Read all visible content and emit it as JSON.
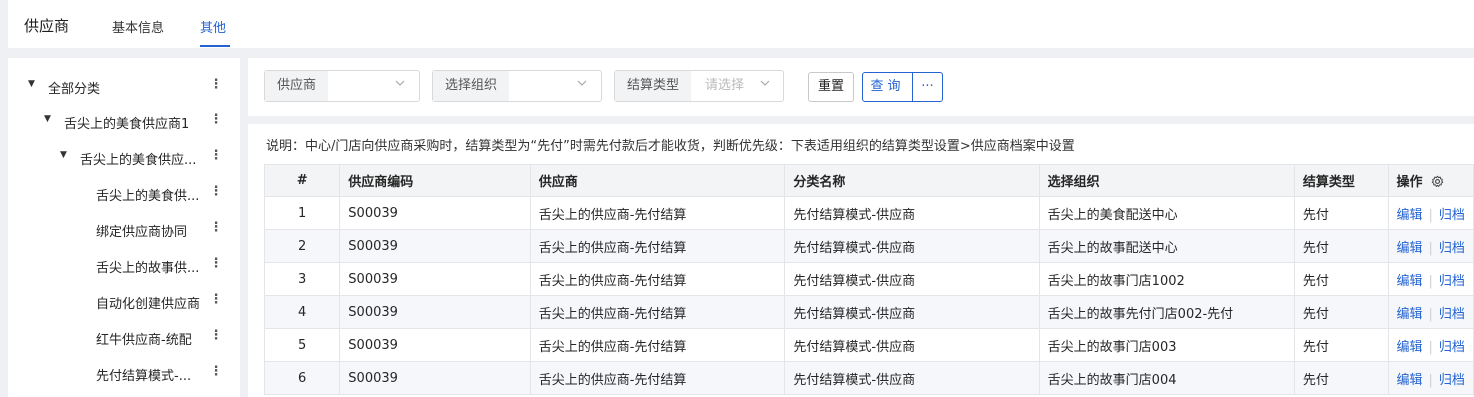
{
  "header": {
    "app_title": "供应商",
    "tabs": [
      {
        "label": "基本信息",
        "active": false
      },
      {
        "label": "其他",
        "active": true
      }
    ]
  },
  "tree": {
    "items": [
      {
        "label": "全部分类",
        "level": 0,
        "expanded": true
      },
      {
        "label": "舌尖上的美食供应商1",
        "level": 1,
        "expanded": true
      },
      {
        "label": "舌尖上的美食供应...",
        "level": 2,
        "expanded": true
      },
      {
        "label": "舌尖上的美食供...",
        "level": 3
      },
      {
        "label": "绑定供应商协同",
        "level": 3
      },
      {
        "label": "舌尖上的故事供...",
        "level": 3
      },
      {
        "label": "自动化创建供应商",
        "level": 3
      },
      {
        "label": "红牛供应商-统配",
        "level": 3
      },
      {
        "label": "先付结算模式-...",
        "level": 3
      }
    ],
    "more_icon": "⋮"
  },
  "filters": {
    "supplier_label": "供应商",
    "org_label": "选择组织",
    "settle_label": "结算类型",
    "settle_placeholder": "请选择",
    "reset_label": "重置",
    "query_label": "查询",
    "more_label": "···"
  },
  "note": "说明：中心/门店向供应商采购时，结算类型为“先付”时需先付款后才能收货，判断优先级：下表适用组织的结算类型设置>供应商档案中设置",
  "table": {
    "headers": {
      "idx": "#",
      "code": "供应商编码",
      "supplier": "供应商",
      "category": "分类名称",
      "org": "选择组织",
      "settle": "结算类型",
      "action": "操作"
    },
    "rows": [
      {
        "idx": "1",
        "code": "S00039",
        "supplier": "舌尖上的供应商-先付结算",
        "category": "先付结算模式-供应商",
        "org": "舌尖上的美食配送中心",
        "settle": "先付",
        "edit": "编辑",
        "archive": "归档"
      },
      {
        "idx": "2",
        "code": "S00039",
        "supplier": "舌尖上的供应商-先付结算",
        "category": "先付结算模式-供应商",
        "org": "舌尖上的故事配送中心",
        "settle": "先付",
        "edit": "编辑",
        "archive": "归档"
      },
      {
        "idx": "3",
        "code": "S00039",
        "supplier": "舌尖上的供应商-先付结算",
        "category": "先付结算模式-供应商",
        "org": "舌尖上的故事门店1002",
        "settle": "先付",
        "edit": "编辑",
        "archive": "归档"
      },
      {
        "idx": "4",
        "code": "S00039",
        "supplier": "舌尖上的供应商-先付结算",
        "category": "先付结算模式-供应商",
        "org": "舌尖上的故事先付门店002-先付",
        "settle": "先付",
        "edit": "编辑",
        "archive": "归档"
      },
      {
        "idx": "5",
        "code": "S00039",
        "supplier": "舌尖上的供应商-先付结算",
        "category": "先付结算模式-供应商",
        "org": "舌尖上的故事门店003",
        "settle": "先付",
        "edit": "编辑",
        "archive": "归档"
      },
      {
        "idx": "6",
        "code": "S00039",
        "supplier": "舌尖上的供应商-先付结算",
        "category": "先付结算模式-供应商",
        "org": "舌尖上的故事门店004",
        "settle": "先付",
        "edit": "编辑",
        "archive": "归档"
      }
    ]
  },
  "colors": {
    "accent": "#2463d1"
  }
}
